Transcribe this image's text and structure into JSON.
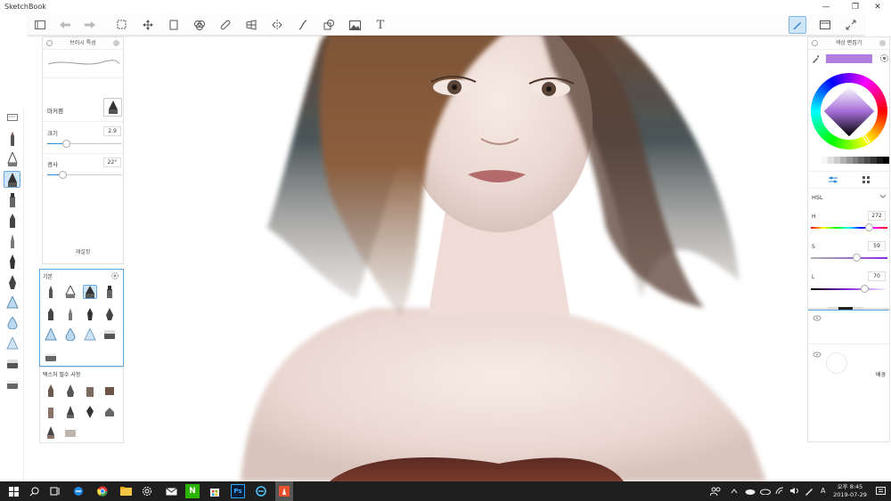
{
  "app": {
    "title": "SketchBook"
  },
  "window_controls": {
    "minimize": "—",
    "maximize": "❐",
    "close": "✕"
  },
  "toolbar": {
    "tools": [
      "gallery-icon",
      "undo-icon",
      "redo-icon",
      "selection-icon",
      "move-icon",
      "crop-icon",
      "color-picker-icon",
      "ruler-icon",
      "perspective-icon",
      "symmetry-icon",
      "stroke-icon",
      "shapes-icon",
      "image-icon",
      "text-icon"
    ],
    "text_tool_glyph": "T",
    "right_tools": [
      "brush-tool-icon",
      "window-icon",
      "fullscreen-icon"
    ]
  },
  "brush_properties": {
    "title": "브러시 특성",
    "brush_name": "마커펜",
    "size_label": "크기",
    "size_value": "2.9",
    "size_fraction": 0.25,
    "angle_label": "경사",
    "angle_value": "22°",
    "angle_fraction": 0.2,
    "reset_label": "재설정"
  },
  "brush_library": {
    "title": "기본"
  },
  "texture_library": {
    "title": "텍스처 필수 사항"
  },
  "color_editor": {
    "title": "색상 편집기",
    "current_color": "#b07fe0",
    "mode": "HSL",
    "h_label": "H",
    "h_value": "272",
    "h_fraction": 0.755,
    "s_label": "S",
    "s_value": "59",
    "s_fraction": 0.59,
    "l_label": "L",
    "l_value": "70",
    "l_fraction": 0.7,
    "swatches": [
      "#f5f5f5",
      "#e0e0e0",
      "#cccccc",
      "#b3b3b3",
      "#999999",
      "#808080",
      "#666666",
      "#4d4d4d",
      "#333333",
      "#1a1a1a",
      "#000000"
    ]
  },
  "layers": {
    "background_label": "배경"
  },
  "taskbar": {
    "apps": [
      "windows-icon",
      "search-icon",
      "task-view-icon",
      "edge-icon",
      "chrome-icon",
      "file-explorer-icon",
      "settings-icon",
      "mail-icon",
      "naver-icon",
      "store-icon",
      "photoshop-icon",
      "ie-icon",
      "sketchbook-icon"
    ],
    "photoshop_glyph": "Ps",
    "naver_glyph": "N",
    "ime": "A",
    "time_period": "오후 8:45",
    "date": "2019-07-29"
  }
}
